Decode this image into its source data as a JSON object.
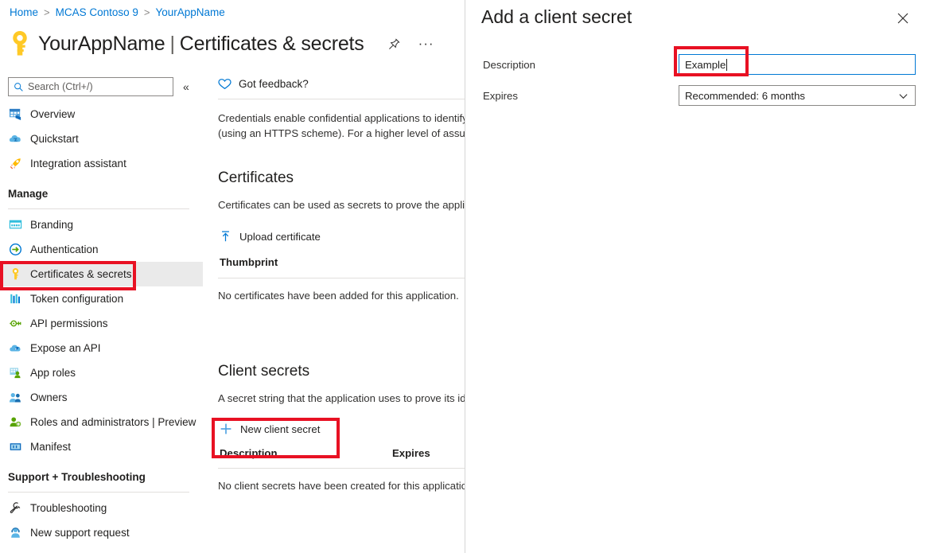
{
  "breadcrumb": {
    "items": [
      "Home",
      "MCAS Contoso 9",
      "YourAppName"
    ],
    "separator": ">"
  },
  "header": {
    "app_name": "YourAppName",
    "divider": "|",
    "section": "Certificates & secrets",
    "key_icon": "key-icon",
    "pin_icon": "pin-icon",
    "more_icon": "ellipsis-icon",
    "ellipsis": "···"
  },
  "sidebar": {
    "search": {
      "placeholder": "Search (Ctrl+/)",
      "value": "",
      "icon": "search-icon"
    },
    "collapse_icon": "«",
    "top_items": [
      {
        "label": "Overview",
        "icon": "overview-grid-icon"
      },
      {
        "label": "Quickstart",
        "icon": "quickstart-cloud-icon"
      },
      {
        "label": "Integration assistant",
        "icon": "rocket-icon"
      }
    ],
    "group_manage": "Manage",
    "manage_items": [
      {
        "label": "Branding",
        "icon": "branding-icon"
      },
      {
        "label": "Authentication",
        "icon": "authentication-icon"
      },
      {
        "label": "Certificates & secrets",
        "icon": "key-icon",
        "selected": true
      },
      {
        "label": "Token configuration",
        "icon": "token-config-icon"
      },
      {
        "label": "API permissions",
        "icon": "api-permissions-icon"
      },
      {
        "label": "Expose an API",
        "icon": "expose-api-icon"
      },
      {
        "label": "App roles",
        "icon": "app-roles-icon"
      },
      {
        "label": "Owners",
        "icon": "owners-icon"
      },
      {
        "label": "Roles and administrators | Preview",
        "icon": "roles-admins-icon"
      },
      {
        "label": "Manifest",
        "icon": "manifest-icon"
      }
    ],
    "group_support": "Support + Troubleshooting",
    "support_items": [
      {
        "label": "Troubleshooting",
        "icon": "wrench-icon"
      },
      {
        "label": "New support request",
        "icon": "support-person-icon"
      }
    ]
  },
  "main": {
    "feedback": {
      "label": "Got feedback?",
      "icon": "heart-icon"
    },
    "intro_line1": "Credentials enable confidential applications to identify",
    "intro_line2": "(using an HTTPS scheme). For a higher level of assuran",
    "certificates": {
      "heading": "Certificates",
      "description": "Certificates can be used as secrets to prove the applica",
      "upload_label": "Upload certificate",
      "upload_icon": "upload-icon",
      "column_thumbprint": "Thumbprint",
      "empty": "No certificates have been added for this application."
    },
    "client_secrets": {
      "heading": "Client secrets",
      "description": "A secret string that the application uses to prove its id",
      "new_label": "New client secret",
      "new_icon": "plus-icon",
      "column_description": "Description",
      "column_expires": "Expires",
      "empty": "No client secrets have been created for this application"
    }
  },
  "panel": {
    "title": "Add a client secret",
    "close_icon": "close-icon",
    "description_label": "Description",
    "description_value": "Example",
    "description_placeholder": "",
    "expires_label": "Expires",
    "expires_value": "Recommended: 6 months",
    "expires_chevron": "chevron-down-icon"
  },
  "annotations": {
    "highlight_color": "#e81123",
    "boxes": [
      {
        "name": "certificates-secrets-nav-highlight"
      },
      {
        "name": "new-client-secret-highlight"
      },
      {
        "name": "description-input-highlight"
      }
    ]
  },
  "colors": {
    "accent": "#0078d4",
    "key_gold": "#ffb900",
    "selected_bg": "#eaeaea",
    "text": "#201f1e"
  }
}
